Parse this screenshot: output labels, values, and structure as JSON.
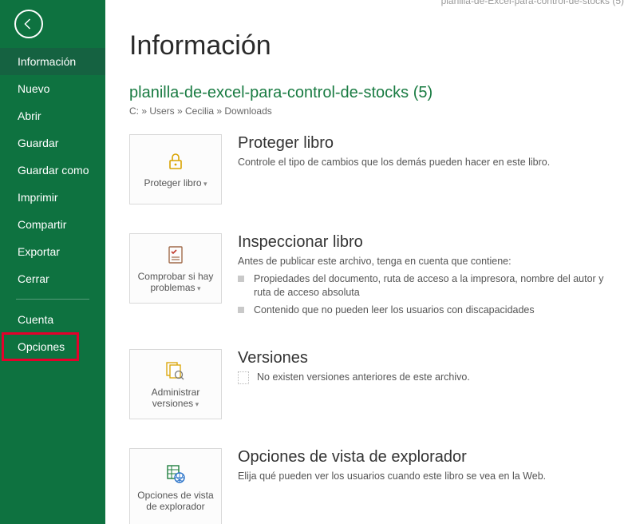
{
  "top_title": "planilla-de-Excel-para-control-de-stocks (5)",
  "sidebar": {
    "items": [
      {
        "label": "Información",
        "selected": true
      },
      {
        "label": "Nuevo"
      },
      {
        "label": "Abrir"
      },
      {
        "label": "Guardar"
      },
      {
        "label": "Guardar como"
      },
      {
        "label": "Imprimir"
      },
      {
        "label": "Compartir"
      },
      {
        "label": "Exportar"
      },
      {
        "label": "Cerrar"
      }
    ],
    "bottom": [
      {
        "label": "Cuenta"
      },
      {
        "label": "Opciones",
        "highlight": true
      }
    ]
  },
  "page": {
    "title": "Información",
    "file_name": "planilla-de-excel-para-control-de-stocks (5)",
    "file_path": "C: » Users » Cecilia » Downloads"
  },
  "sections": {
    "protect": {
      "card_label": "Proteger libro",
      "title": "Proteger libro",
      "desc": "Controle el tipo de cambios que los demás pueden hacer en este libro."
    },
    "inspect": {
      "card_label": "Comprobar si hay problemas",
      "title": "Inspeccionar libro",
      "desc": "Antes de publicar este archivo, tenga en cuenta que contiene:",
      "bullets": [
        "Propiedades del documento, ruta de acceso a la impresora, nombre del autor y ruta de acceso absoluta",
        "Contenido que no pueden leer los usuarios con discapacidades"
      ]
    },
    "versions": {
      "card_label": "Administrar versiones",
      "title": "Versiones",
      "desc": "No existen versiones anteriores de este archivo."
    },
    "browser": {
      "card_label": "Opciones de vista de explorador",
      "title": "Opciones de vista de explorador",
      "desc": "Elija qué pueden ver los usuarios cuando este libro se vea en la Web."
    }
  }
}
